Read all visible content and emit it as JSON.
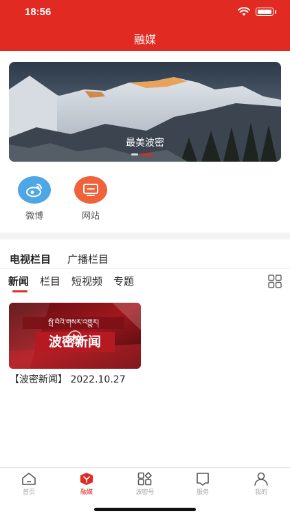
{
  "status_bar": {
    "time": "18:56"
  },
  "header": {
    "title": "融媒"
  },
  "banner": {
    "caption": "最美波密",
    "slide_count": 2,
    "active_slide": 2
  },
  "shortcuts": [
    {
      "label": "微博",
      "icon": "weibo-icon",
      "color": "#4fa6e6"
    },
    {
      "label": "网站",
      "icon": "monitor-icon",
      "color": "#f0623a"
    }
  ],
  "column_tabs": [
    {
      "label": "电视栏目",
      "active": true
    },
    {
      "label": "广播栏目",
      "active": false
    }
  ],
  "sub_tabs": [
    {
      "label": "新闻",
      "active": true
    },
    {
      "label": "栏目",
      "active": false
    },
    {
      "label": "短视频",
      "active": false
    },
    {
      "label": "专题",
      "active": false
    }
  ],
  "news": [
    {
      "thumbnail_tibetan": "སྤོ་བོའི་གསར་འགྱུར།",
      "thumbnail_title": "波密新闻",
      "title": "【波密新闻】 2022.10.27"
    }
  ],
  "tabbar": [
    {
      "label": "首页",
      "icon": "home-icon",
      "active": false
    },
    {
      "label": "融媒",
      "icon": "media-icon",
      "active": true
    },
    {
      "label": "波密号",
      "icon": "apps-icon",
      "active": false
    },
    {
      "label": "服务",
      "icon": "bookmark-icon",
      "active": false
    },
    {
      "label": "我的",
      "icon": "user-icon",
      "active": false
    }
  ],
  "colors": {
    "brand": "#e02a22",
    "weibo": "#4fa6e6",
    "website": "#f0623a"
  }
}
